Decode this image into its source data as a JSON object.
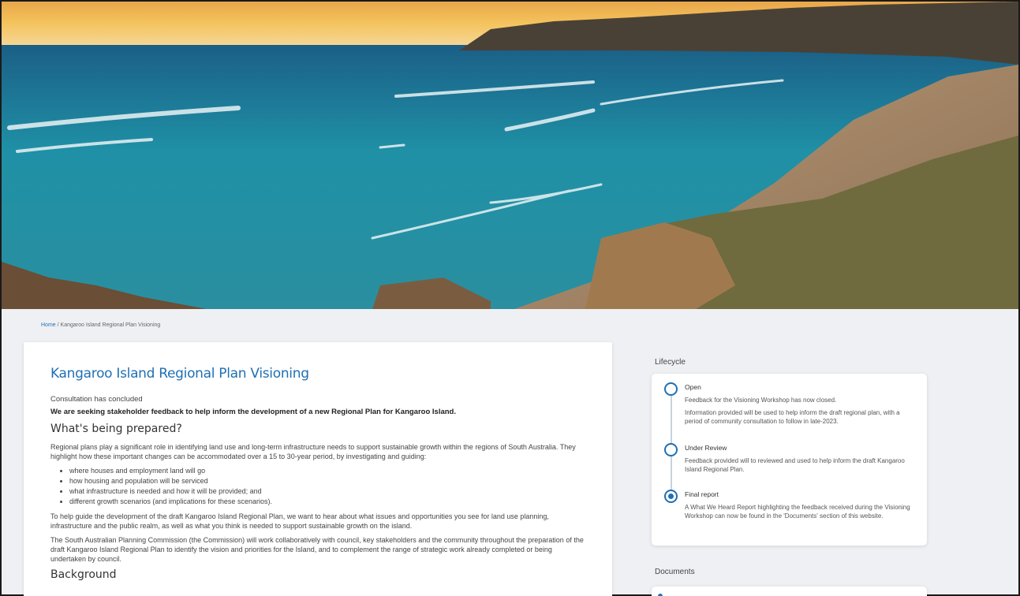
{
  "breadcrumb": {
    "home": "Home",
    "separator": "/",
    "current": "Kangaroo Island Regional Plan Visioning"
  },
  "main": {
    "title": "Kangaroo Island Regional Plan Visioning",
    "status": "Consultation has concluded",
    "lead": "We are seeking stakeholder feedback to help inform the development of a new Regional Plan for Kangaroo Island.",
    "section1_heading": "What's being prepared?",
    "para1": "Regional plans play a significant role in identifying land use and long-term infrastructure needs to support sustainable growth within the regions of South Australia. They highlight how these important changes can be accommodated over a 15 to 30-year period, by investigating and guiding:",
    "bullets": [
      "where houses and employment land will go",
      "how housing and population will be serviced",
      "what infrastructure is needed and how it will be provided; and",
      "different growth scenarios (and implications for these scenarios)."
    ],
    "para2": "To help guide the development of the draft Kangaroo Island Regional Plan, we want to hear about what issues and opportunities you see for land use planning, infrastructure and the public realm, as well as what you think is needed to support sustainable growth on the island.",
    "para3": "The South Australian Planning Commission (the Commission) will work collaboratively with council, key stakeholders and the community throughout the preparation of the draft Kangaroo Island Regional Plan to identify the vision and priorities for the Island, and to complement the range of strategic work already completed or being undertaken by council.",
    "section2_heading": "Background"
  },
  "lifecycle": {
    "label": "Lifecycle",
    "stages": [
      {
        "title": "Open",
        "text1": "Feedback for the Visioning Workshop has now closed.",
        "text2": "Information provided will be used to help inform the draft regional plan, with a period of community consultation to follow in late-2023."
      },
      {
        "title": "Under Review",
        "text1": "Feedback provided will to reviewed and used to help inform the draft Kangaroo Island Regional Plan."
      },
      {
        "title": "Final report",
        "text1": "A What We Heard Report highlighting the feedback received during the Visioning Workshop can now be found in the 'Documents' section of this website."
      }
    ]
  },
  "documents": {
    "label": "Documents"
  },
  "colors": {
    "accent": "#1f6fb5",
    "background": "#eef0f3"
  }
}
